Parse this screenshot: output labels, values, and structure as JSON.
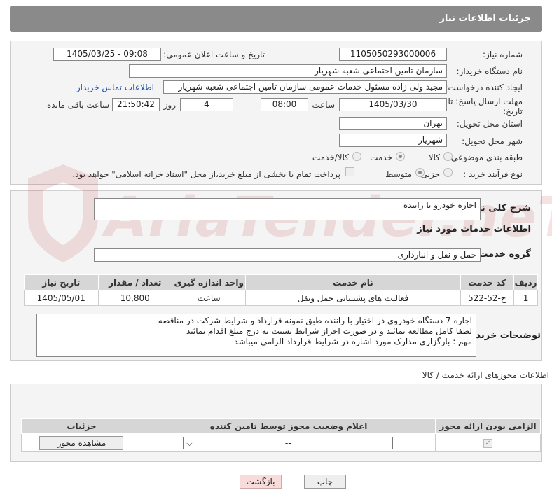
{
  "header": {
    "title": "جزئیات اطلاعات نیاز"
  },
  "form": {
    "need_number_label": "شماره نیاز:",
    "need_number": "1105050293000006",
    "announce_label": "تاریخ و ساعت اعلان عمومی:",
    "announce_value": "1405/03/25 - 09:08",
    "buyer_org_label": "نام دستگاه خریدار:",
    "buyer_org": "سازمان تامین اجتماعی شعبه شهریار",
    "creator_label": "ایجاد کننده درخواست:",
    "creator": "مجید ولی زاده مسئول خدمات عمومی سازمان تامین اجتماعی شعبه شهریار",
    "contact_link": "اطلاعات تماس خریدار",
    "deadline_label_1": "مهلت ارسال پاسخ: تا",
    "deadline_label_2": "تاریخ:",
    "deadline_date": "1405/03/30",
    "time_label": "ساعت",
    "deadline_time": "08:00",
    "days_value": "4",
    "days_label": "روز و",
    "remaining_time": "21:50:42",
    "remaining_label": "ساعت باقی مانده",
    "province_label": "استان محل تحویل:",
    "province": "تهران",
    "city_label": "شهر محل تحویل:",
    "city": "شهریار",
    "category_label": "طبقه بندی موضوعی:",
    "category_options": [
      "کالا",
      "خدمت",
      "کالا/خدمت"
    ],
    "category_selected": "خدمت",
    "process_label": "نوع فرآیند خرید :",
    "process_options": [
      "جزیی",
      "متوسط"
    ],
    "process_selected": "متوسط",
    "payment_note": "پرداخت تمام یا بخشی از مبلغ خرید،از محل \"اسناد خزانه اسلامی\" خواهد بود."
  },
  "needs": {
    "summary_label": "شرح کلی نیاز:",
    "summary": "اجاره خودرو با راننده",
    "services_title": "اطلاعات خدمات مورد نیاز",
    "group_label": "گروه خدمت:",
    "group_value": "حمل و نقل و انبارداری",
    "table_headers": [
      "ردیف",
      "کد خدمت",
      "نام خدمت",
      "واحد اندازه گیری",
      "تعداد / مقدار",
      "تاریخ نیاز"
    ],
    "rows": [
      [
        "1",
        "ح-52-522",
        "فعالیت های پشتیبانی حمل ونقل",
        "ساعت",
        "10,800",
        "1405/05/01"
      ]
    ],
    "buyer_notes_label": "توضیحات خریدار:",
    "buyer_notes": "اجاره 7 دستگاه خودروی در اختیار با راننده طبق نمونه قرارداد و شرایط شرکت در مناقصه\nلطفا کامل مطالعه نمائید و در صورت احراز شرایط نسبت به درج مبلغ اقدام نمائید\nمهم : بارگزاری مدارک مورد اشاره در شرایط قرارداد الزامی میباشد"
  },
  "licenses": {
    "section_title": "اطلاعات مجوزهای ارائه خدمت / کالا",
    "headers": [
      "الزامی بودن ارائه مجوز",
      "اعلام وضعیت مجوز توسط تامین کننده",
      "جزئیات"
    ],
    "select_value": "--",
    "view_button": "مشاهده مجوز"
  },
  "footer": {
    "print_button": "چاپ",
    "back_button": "بازگشت"
  },
  "watermark": {
    "text": "AriaTender.neT"
  },
  "colors": {
    "header_bg": "#8a8a8a",
    "link": "#1a54a8",
    "back_button_bg": "#f8dcdc",
    "watermark": "#b71c1c"
  }
}
